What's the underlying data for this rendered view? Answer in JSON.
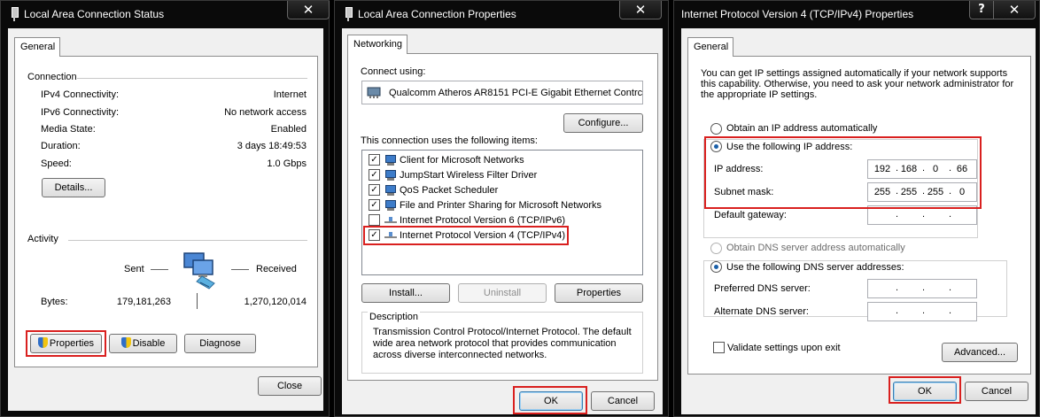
{
  "status_window": {
    "title": "Local Area Connection Status",
    "close_glyph": "✕",
    "tab": "General",
    "connection_heading": "Connection",
    "rows": [
      {
        "label": "IPv4 Connectivity:",
        "value": "Internet"
      },
      {
        "label": "IPv6 Connectivity:",
        "value": "No network access"
      },
      {
        "label": "Media State:",
        "value": "Enabled"
      },
      {
        "label": "Duration:",
        "value": "3 days 18:49:53"
      },
      {
        "label": "Speed:",
        "value": "1.0 Gbps"
      }
    ],
    "details_button": "Details...",
    "activity_heading": "Activity",
    "sent_label": "Sent",
    "received_label": "Received",
    "bytes_label": "Bytes:",
    "bytes_sent": "179,181,263",
    "bytes_received": "1,270,120,014",
    "properties_button": "Properties",
    "disable_button": "Disable",
    "diagnose_button": "Diagnose",
    "close_button": "Close"
  },
  "props_window": {
    "title": "Local Area Connection Properties",
    "close_glyph": "✕",
    "tab": "Networking",
    "connect_using_label": "Connect using:",
    "adapter_name": "Qualcomm Atheros AR8151 PCI-E Gigabit Ethernet Contrc",
    "configure_button": "Configure...",
    "items_label": "This connection uses the following items:",
    "items": [
      {
        "label": "Client for Microsoft Networks",
        "checked": true,
        "icon": "network-client-icon"
      },
      {
        "label": "JumpStart Wireless Filter Driver",
        "checked": true,
        "icon": "network-client-icon"
      },
      {
        "label": "QoS Packet Scheduler",
        "checked": true,
        "icon": "network-client-icon"
      },
      {
        "label": "File and Printer Sharing for Microsoft Networks",
        "checked": true,
        "icon": "network-client-icon"
      },
      {
        "label": "Internet Protocol Version 6 (TCP/IPv6)",
        "checked": false,
        "icon": "protocol-icon"
      },
      {
        "label": "Internet Protocol Version 4 (TCP/IPv4)",
        "checked": true,
        "icon": "protocol-icon"
      }
    ],
    "install_button": "Install...",
    "uninstall_button": "Uninstall",
    "properties_button": "Properties",
    "description_heading": "Description",
    "description_text": "Transmission Control Protocol/Internet Protocol. The default wide area network protocol that provides communication across diverse interconnected networks.",
    "ok_button": "OK",
    "cancel_button": "Cancel"
  },
  "ipv4_window": {
    "title": "Internet Protocol Version 4 (TCP/IPv4) Properties",
    "help_glyph": "?",
    "close_glyph": "✕",
    "tab": "General",
    "intro_text": "You can get IP settings assigned automatically if your network supports this capability. Otherwise, you need to ask your network administrator for the appropriate IP settings.",
    "obtain_ip_auto": "Obtain an IP address automatically",
    "use_following_ip": "Use the following IP address:",
    "ip_address_label": "IP address:",
    "ip_address": [
      "192",
      "168",
      "0",
      "66"
    ],
    "subnet_label": "Subnet mask:",
    "subnet_mask": [
      "255",
      "255",
      "255",
      "0"
    ],
    "gateway_label": "Default gateway:",
    "gateway": [
      "",
      "",
      "",
      ""
    ],
    "obtain_dns_auto": "Obtain DNS server address automatically",
    "use_following_dns": "Use the following DNS server addresses:",
    "preferred_dns_label": "Preferred DNS server:",
    "preferred_dns": [
      "",
      "",
      "",
      ""
    ],
    "alternate_dns_label": "Alternate DNS server:",
    "alternate_dns": [
      "",
      "",
      "",
      ""
    ],
    "validate_label": "Validate settings upon exit",
    "advanced_button": "Advanced...",
    "ok_button": "OK",
    "cancel_button": "Cancel",
    "dot": "."
  },
  "accent_colors": {
    "highlight_box": "#d9201f",
    "radio_fill": "#1a5fa8"
  }
}
